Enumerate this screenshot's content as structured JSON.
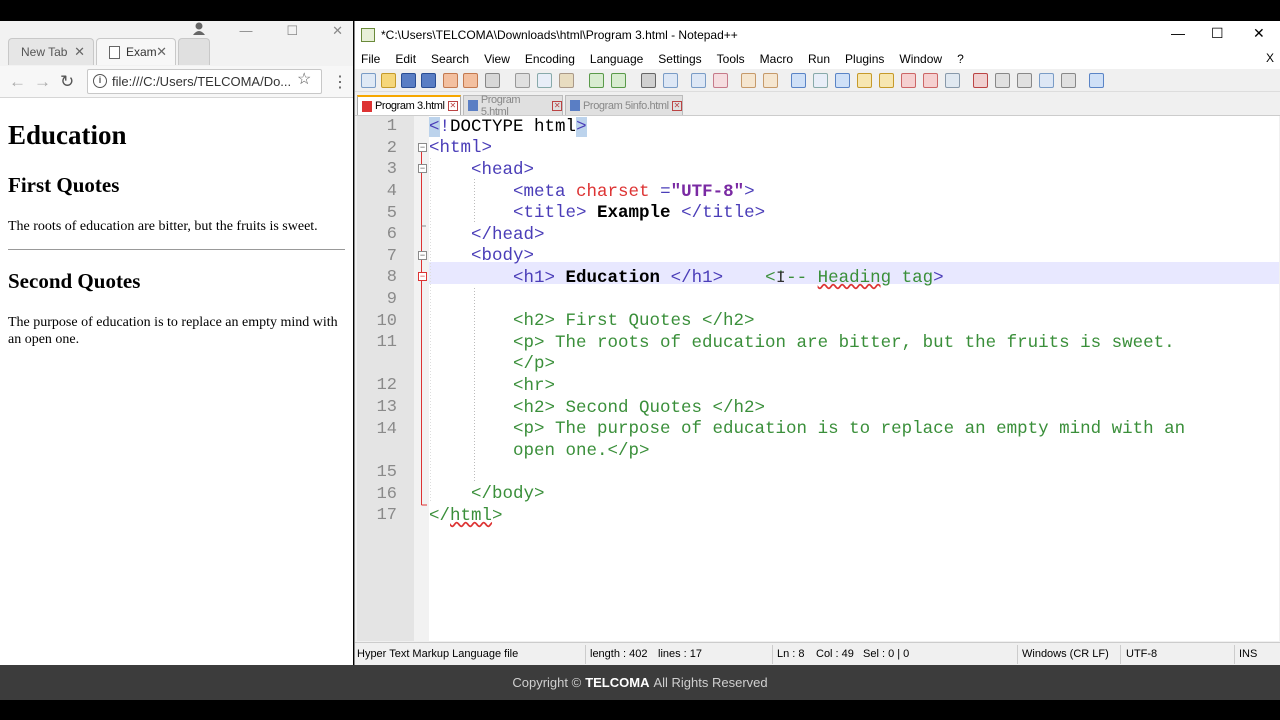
{
  "browser": {
    "tabs": [
      {
        "label": "New Tab"
      },
      {
        "label": "Exam"
      }
    ],
    "address": "file:///C:/Users/TELCOMA/Do...",
    "page": {
      "h1": "Education",
      "h2_first": "First Quotes",
      "p_first": "The roots of education are bitter, but the fruits is sweet.",
      "h2_second": "Second Quotes",
      "p_second": "The purpose of education is to replace an empty mind with an open one."
    }
  },
  "notepad": {
    "title": "*C:\\Users\\TELCOMA\\Downloads\\html\\Program 3.html - Notepad++",
    "menu": [
      "File",
      "Edit",
      "Search",
      "View",
      "Encoding",
      "Language",
      "Settings",
      "Tools",
      "Macro",
      "Run",
      "Plugins",
      "Window",
      "?"
    ],
    "menu_close": "X",
    "file_tabs": [
      {
        "label": "Program 3.html",
        "active": true
      },
      {
        "label": "Program 5.html",
        "active": false
      },
      {
        "label": "Program 5info.html",
        "active": false
      }
    ],
    "line_numbers": [
      "1",
      "2",
      "3",
      "4",
      "5",
      "6",
      "7",
      "8",
      "9",
      "10",
      "11",
      "",
      "12",
      "13",
      "14",
      "",
      "15",
      "16",
      "17"
    ],
    "status": {
      "file_type": "Hyper Text Markup Language file",
      "length": "length : 402",
      "lines": "lines : 17",
      "ln": "Ln : 8",
      "col": "Col : 49",
      "sel": "Sel : 0 | 0",
      "eol": "Windows (CR LF)",
      "encoding": "UTF-8",
      "mode": "INS"
    }
  },
  "footer": {
    "prefix": "Copyright ©",
    "brand": "TELCOMA",
    "suffix": "All Rights Reserved"
  }
}
